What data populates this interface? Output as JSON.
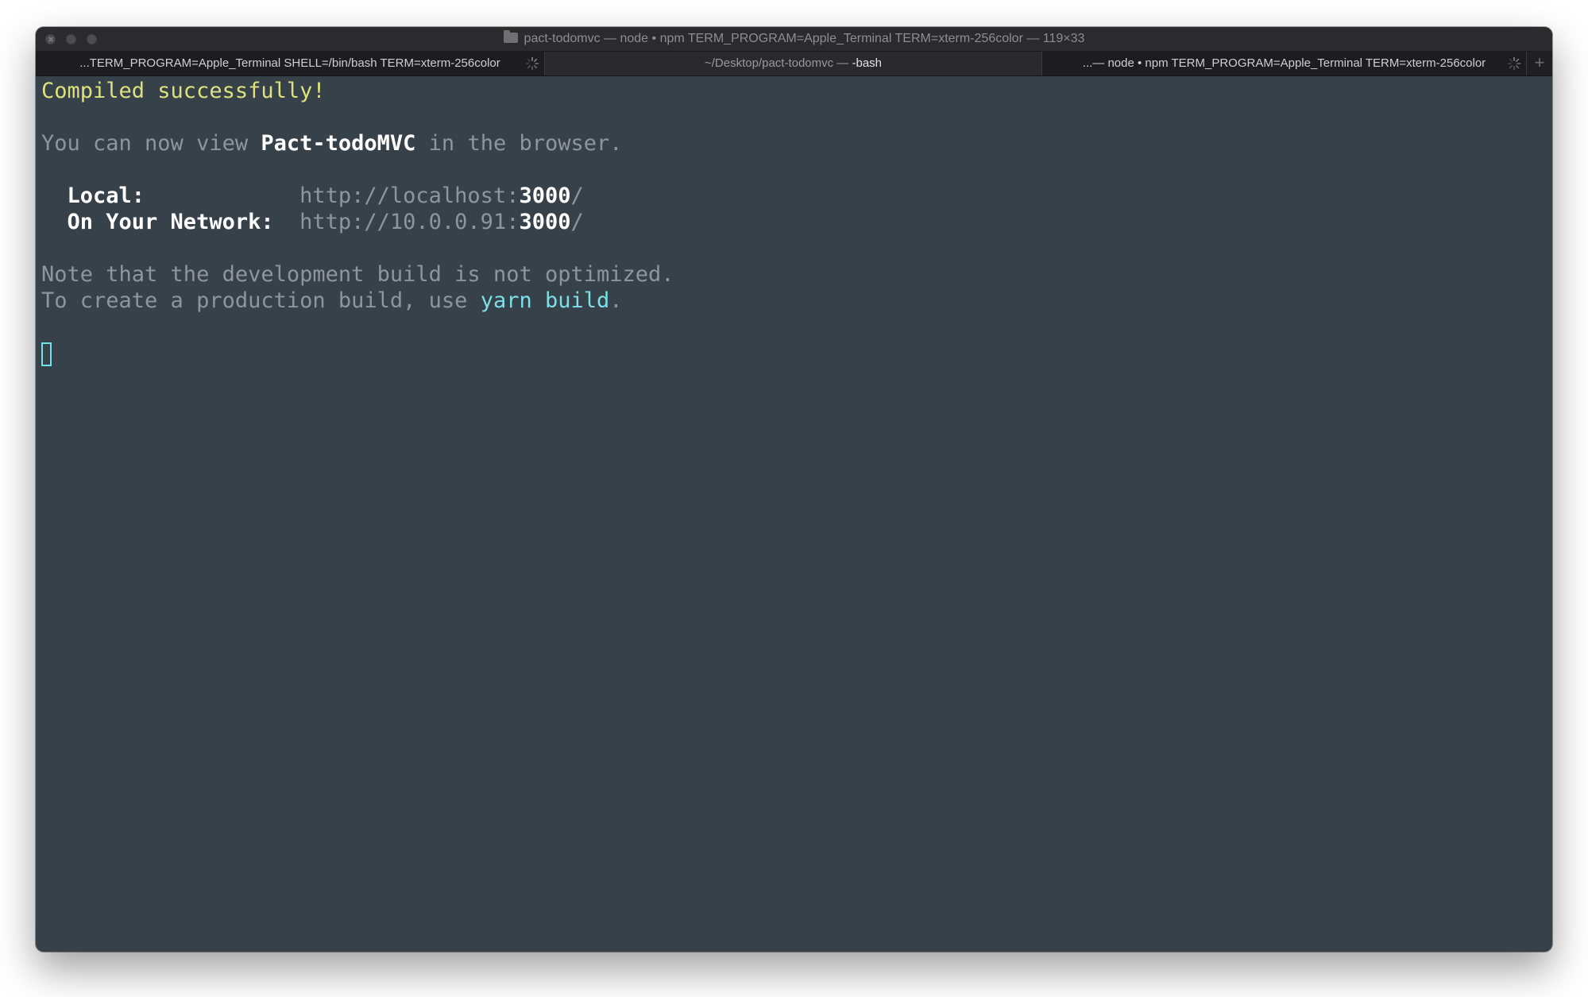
{
  "window": {
    "title": "pact-todomvc — node • npm TERM_PROGRAM=Apple_Terminal TERM=xterm-256color — 119×33"
  },
  "tabs": [
    {
      "label": "...TERM_PROGRAM=Apple_Terminal SHELL=/bin/bash TERM=xterm-256color",
      "active": false,
      "busy": true
    },
    {
      "label_prefix": "~/Desktop/pact-todomvc — ",
      "label_emph": "-bash",
      "active": true,
      "busy": false
    },
    {
      "label": "...— node • npm TERM_PROGRAM=Apple_Terminal TERM=xterm-256color",
      "active": false,
      "busy": true
    }
  ],
  "new_tab_label": "+",
  "terminal": {
    "compiled": "Compiled successfully!",
    "view_prefix": "You can now view ",
    "app_name": "Pact-todoMVC",
    "view_suffix": " in the browser.",
    "local_label": "  Local:            ",
    "local_url_prefix": "http://localhost:",
    "local_port": "3000",
    "local_url_suffix": "/",
    "network_label": "  On Your Network:  ",
    "network_url_prefix": "http://10.0.0.91:",
    "network_port": "3000",
    "network_url_suffix": "/",
    "note_line": "Note that the development build is not optimized.",
    "prod_prefix": "To create a production build, use ",
    "prod_cmd": "yarn build",
    "prod_suffix": "."
  },
  "colors": {
    "background": "#37414a",
    "success": "#dde27c",
    "command": "#7ddfe8",
    "text": "#8e969c",
    "emphasis": "#ffffff"
  }
}
